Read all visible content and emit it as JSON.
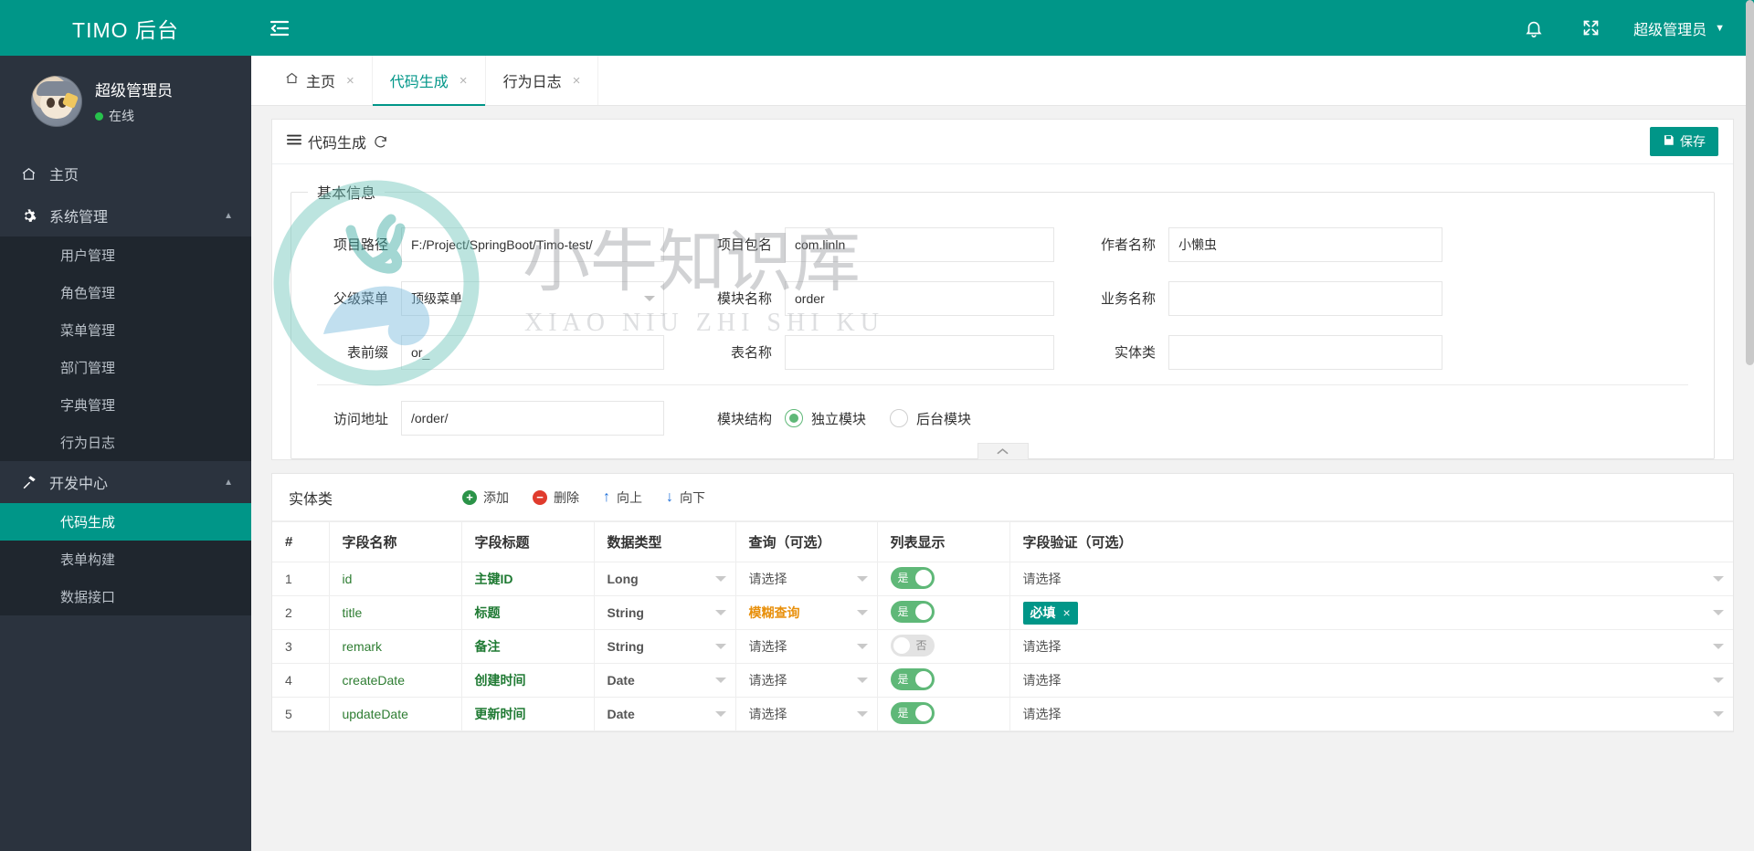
{
  "brand": {
    "logo_text": "TIMO 后台"
  },
  "profile": {
    "name": "超级管理员",
    "status": "在线"
  },
  "sidebar": {
    "items": [
      {
        "label": "主页",
        "icon": "home-icon"
      },
      {
        "label": "系统管理",
        "icon": "gear-icon",
        "caret": "▲"
      },
      {
        "label": "开发中心",
        "icon": "hammer-icon",
        "caret": "▲"
      }
    ],
    "system_children": [
      {
        "label": "用户管理"
      },
      {
        "label": "角色管理"
      },
      {
        "label": "菜单管理"
      },
      {
        "label": "部门管理"
      },
      {
        "label": "字典管理"
      },
      {
        "label": "行为日志"
      }
    ],
    "dev_children": [
      {
        "label": "代码生成",
        "active": true
      },
      {
        "label": "表单构建",
        "active": false
      },
      {
        "label": "数据接口",
        "active": false
      }
    ]
  },
  "header": {
    "hamburger_icon": "menu-fold-icon",
    "bell_icon": "bell-icon",
    "fullscreen_icon": "fullscreen-icon",
    "user_label": "超级管理员",
    "user_caret": "▼"
  },
  "tabs": [
    {
      "label": "主页",
      "icon": "home-icon",
      "close": "×",
      "active": false
    },
    {
      "label": "代码生成",
      "close": "×",
      "active": true
    },
    {
      "label": "行为日志",
      "close": "×",
      "active": false
    }
  ],
  "card": {
    "title": "代码生成",
    "menu_icon": "list-icon",
    "refresh_icon": "refresh-icon",
    "save_label": "保存",
    "save_icon": "save-icon"
  },
  "basic": {
    "legend": "基本信息",
    "fields": [
      {
        "label": "项目路径",
        "value": "F:/Project/SpringBoot/Timo-test/",
        "placeholder": "",
        "type": "text"
      },
      {
        "label": "项目包名",
        "value": "com.linln",
        "placeholder": "",
        "type": "text"
      },
      {
        "label": "作者名称",
        "value": "小懒虫",
        "placeholder": "",
        "type": "text"
      },
      {
        "label": "父级菜单",
        "value": "顶级菜单",
        "placeholder": "",
        "type": "select"
      },
      {
        "label": "模块名称",
        "value": "order",
        "placeholder": "",
        "type": "text"
      },
      {
        "label": "业务名称",
        "value": "",
        "placeholder": "",
        "type": "text"
      },
      {
        "label": "表前缀",
        "value": "or_",
        "placeholder": "",
        "type": "text"
      },
      {
        "label": "表名称",
        "value": "",
        "placeholder": "",
        "type": "text"
      },
      {
        "label": "实体类",
        "value": "",
        "placeholder": "",
        "type": "text"
      }
    ],
    "url_label": "访问地址",
    "url_value": "/order/",
    "struct_label": "模块结构",
    "struct_options": [
      {
        "label": "独立模块",
        "checked": true
      },
      {
        "label": "后台模块",
        "checked": false
      }
    ],
    "collapse_icon": "chevron-up-icon"
  },
  "entity": {
    "title": "实体类",
    "actions": [
      {
        "label": "添加",
        "icon": "plus-circle-icon"
      },
      {
        "label": "删除",
        "icon": "minus-circle-icon"
      },
      {
        "label": "向上",
        "icon": "arrow-up-icon"
      },
      {
        "label": "向下",
        "icon": "arrow-down-icon"
      }
    ],
    "columns": [
      "#",
      "字段名称",
      "字段标题",
      "数据类型",
      "查询（可选）",
      "列表显示",
      "字段验证（可选）"
    ],
    "rows": [
      {
        "idx": "1",
        "field": "id",
        "title": "主键ID",
        "type": "Long",
        "query": "请选择",
        "query_set": false,
        "list": "是",
        "list_on": true,
        "validate": "请选择",
        "tags": []
      },
      {
        "idx": "2",
        "field": "title",
        "title": "标题",
        "type": "String",
        "query": "模糊查询",
        "query_set": true,
        "list": "是",
        "list_on": true,
        "validate": "",
        "tags": [
          "必填"
        ]
      },
      {
        "idx": "3",
        "field": "remark",
        "title": "备注",
        "type": "String",
        "query": "请选择",
        "query_set": false,
        "list": "否",
        "list_on": false,
        "validate": "请选择",
        "tags": []
      },
      {
        "idx": "4",
        "field": "createDate",
        "title": "创建时间",
        "type": "Date",
        "query": "请选择",
        "query_set": false,
        "list": "是",
        "list_on": true,
        "validate": "请选择",
        "tags": []
      },
      {
        "idx": "5",
        "field": "updateDate",
        "title": "更新时间",
        "type": "Date",
        "query": "请选择",
        "query_set": false,
        "list": "是",
        "list_on": true,
        "validate": "请选择",
        "tags": []
      }
    ]
  },
  "watermark": {
    "text_cn": "小牛知识库",
    "text_en": "XIAO NIU ZHI SHI KU"
  },
  "colors": {
    "brand": "#009688",
    "sidebar": "#2b333e",
    "accent_green": "#5fb878",
    "warn": "#e8900c"
  }
}
